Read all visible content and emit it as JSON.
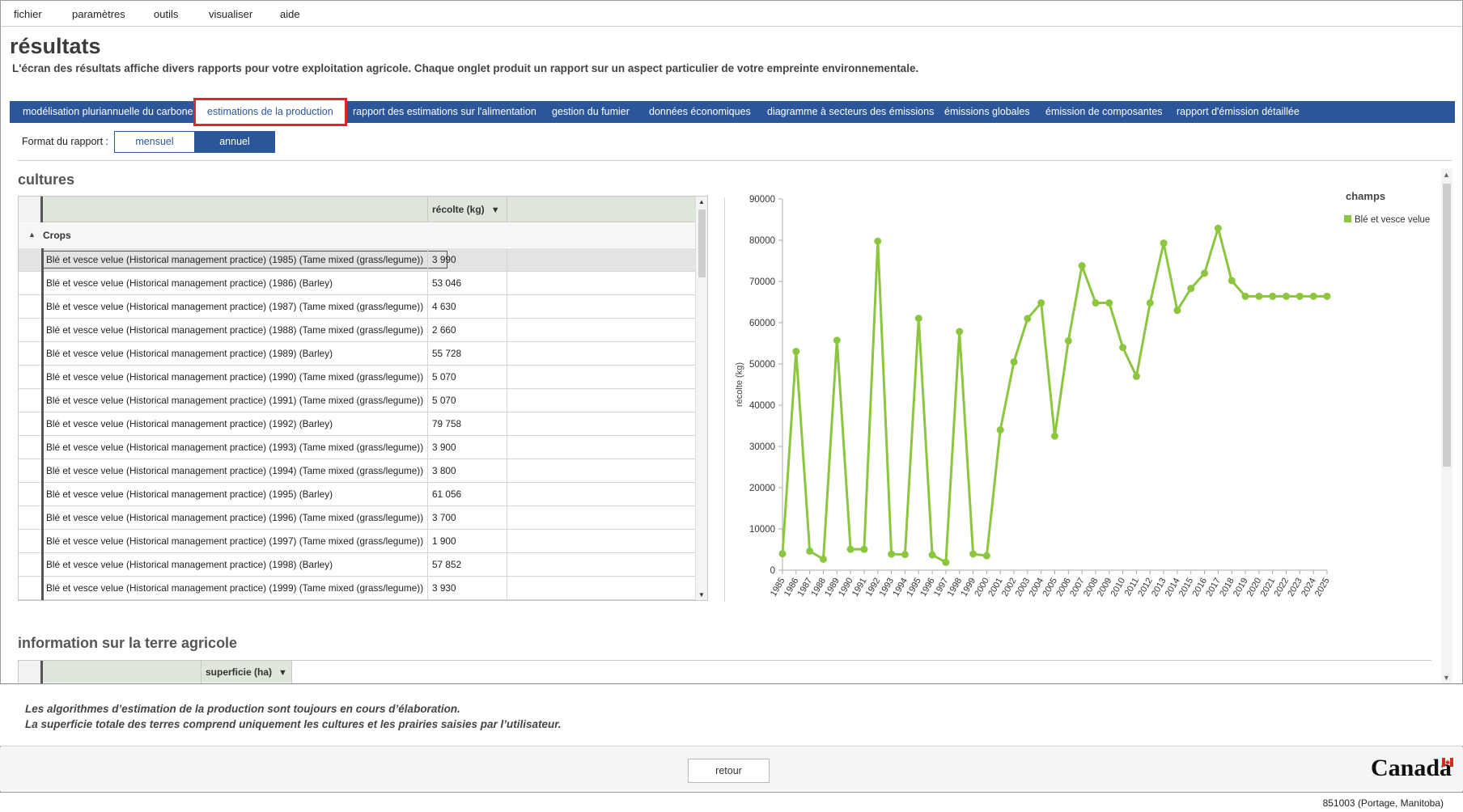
{
  "menu": {
    "items": [
      "fichier",
      "paramètres",
      "outils",
      "visualiser",
      "aide"
    ]
  },
  "header": {
    "title": "résultats",
    "subtitle": "L'écran des résultats affiche divers rapports pour votre exploitation agricole. Chaque onglet produit un rapport sur un aspect particulier de votre empreinte environnementale."
  },
  "tabs": [
    {
      "label": "modélisation pluriannuelle du carbone",
      "active": false
    },
    {
      "label": "estimations de la production",
      "active": true
    },
    {
      "label": "rapport des estimations sur l'alimentation",
      "active": false
    },
    {
      "label": "gestion du fumier",
      "active": false
    },
    {
      "label": "données économiques",
      "active": false
    },
    {
      "label": "diagramme à secteurs des émissions",
      "active": false
    },
    {
      "label": "émissions globales",
      "active": false
    },
    {
      "label": "émission de composantes",
      "active": false
    },
    {
      "label": "rapport d'émission détaillée",
      "active": false
    }
  ],
  "format": {
    "label": "Format du rapport :",
    "mensuel": "mensuel",
    "annuel": "annuel",
    "selected": "annuel"
  },
  "cultures": {
    "title": "cultures",
    "column_header": "récolte (kg)",
    "group_label": "Crops",
    "rows": [
      {
        "name": "Blé et vesce velue (Historical management practice) (1985)  (Tame mixed (grass/legume))",
        "value": "3 990"
      },
      {
        "name": "Blé et vesce velue (Historical management practice) (1986)  (Barley)",
        "value": "53 046"
      },
      {
        "name": "Blé et vesce velue (Historical management practice) (1987)  (Tame mixed (grass/legume))",
        "value": "4 630"
      },
      {
        "name": "Blé et vesce velue (Historical management practice) (1988)  (Tame mixed (grass/legume))",
        "value": "2 660"
      },
      {
        "name": "Blé et vesce velue (Historical management practice) (1989)  (Barley)",
        "value": "55 728"
      },
      {
        "name": "Blé et vesce velue (Historical management practice) (1990)  (Tame mixed (grass/legume))",
        "value": "5 070"
      },
      {
        "name": "Blé et vesce velue (Historical management practice) (1991)  (Tame mixed (grass/legume))",
        "value": "5 070"
      },
      {
        "name": "Blé et vesce velue (Historical management practice) (1992)  (Barley)",
        "value": "79 758"
      },
      {
        "name": "Blé et vesce velue (Historical management practice) (1993)  (Tame mixed (grass/legume))",
        "value": "3 900"
      },
      {
        "name": "Blé et vesce velue (Historical management practice) (1994)  (Tame mixed (grass/legume))",
        "value": "3 800"
      },
      {
        "name": "Blé et vesce velue (Historical management practice) (1995)  (Barley)",
        "value": "61 056"
      },
      {
        "name": "Blé et vesce velue (Historical management practice) (1996)  (Tame mixed (grass/legume))",
        "value": "3 700"
      },
      {
        "name": "Blé et vesce velue (Historical management practice) (1997)  (Tame mixed (grass/legume))",
        "value": "1 900"
      },
      {
        "name": "Blé et vesce velue (Historical management practice) (1998)  (Barley)",
        "value": "57 852"
      },
      {
        "name": "Blé et vesce velue (Historical management practice) (1999)  (Tame mixed (grass/legume))",
        "value": "3 930"
      }
    ]
  },
  "chart_data": {
    "type": "line",
    "title": "",
    "xlabel": "",
    "ylabel": "récolte (kg)",
    "legend_title": "champs",
    "legend_position": "top-right",
    "ylim": [
      0,
      90000
    ],
    "yticks": [
      "0",
      "10000",
      "20000",
      "30000",
      "40000",
      "50000",
      "60000",
      "70000",
      "80000",
      "90000"
    ],
    "x": [
      "1985",
      "1986",
      "1987",
      "1988",
      "1989",
      "1990",
      "1991",
      "1992",
      "1993",
      "1994",
      "1995",
      "1996",
      "1997",
      "1998",
      "1999",
      "2000",
      "2001",
      "2002",
      "2003",
      "2004",
      "2005",
      "2006",
      "2007",
      "2008",
      "2009",
      "2010",
      "2011",
      "2012",
      "2013",
      "2014",
      "2015",
      "2016",
      "2017",
      "2018",
      "2019",
      "2020",
      "2021",
      "2022",
      "2023",
      "2024",
      "2025"
    ],
    "series": [
      {
        "name": "Blé et vesce velue",
        "color": "#8cc63f",
        "values": [
          3990,
          53046,
          4630,
          2660,
          55728,
          5070,
          5070,
          79758,
          3900,
          3800,
          61056,
          3700,
          1900,
          57852,
          3930,
          3500,
          34000,
          50500,
          61000,
          64800,
          32500,
          55600,
          73800,
          64800,
          64800,
          54000,
          47000,
          64800,
          79300,
          63000,
          68300,
          72000,
          82900,
          70200,
          66400,
          66400,
          66400,
          66400,
          66400,
          66400,
          66400
        ]
      }
    ]
  },
  "terre": {
    "title": "information sur la terre agricole",
    "column_header": "superficie (ha)"
  },
  "notes": [
    "Les algorithmes d’estimation de la production sont toujours en cours d’élaboration.",
    "La superficie totale des terres comprend uniquement les cultures et les prairies saisies par l’utilisateur."
  ],
  "footer": {
    "retour_label": "retour",
    "wordmark": "Canada"
  },
  "status": {
    "location": "851003 (Portage, Manitoba)"
  }
}
